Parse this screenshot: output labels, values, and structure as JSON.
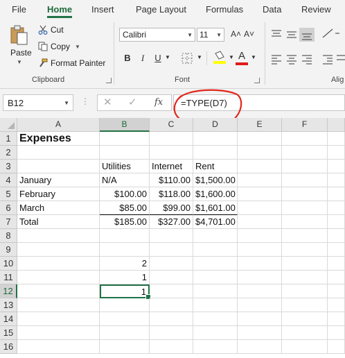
{
  "tabs": [
    "File",
    "Home",
    "Insert",
    "Page Layout",
    "Formulas",
    "Data",
    "Review"
  ],
  "active_tab": "Home",
  "clipboard": {
    "paste_label": "Paste",
    "cut_label": "Cut",
    "copy_label": "Copy",
    "format_painter_label": "Format Painter",
    "group_label": "Clipboard"
  },
  "font": {
    "name": "Calibri",
    "size": "11",
    "bold": "B",
    "italic": "I",
    "underline": "U",
    "grow": "A˄",
    "shrink": "A˅",
    "font_color_glyph": "A",
    "group_label": "Font",
    "fill_color": "#ffff00",
    "font_color": "#e01b1b"
  },
  "alignment": {
    "group_label": "Alig"
  },
  "formula_bar": {
    "name_box": "B12",
    "formula": "=TYPE(D7)",
    "fx": "fx",
    "annotation_color": "#e0261b"
  },
  "grid": {
    "columns": [
      "A",
      "B",
      "C",
      "D",
      "E",
      "F"
    ],
    "selected_column": "B",
    "rows": [
      "1",
      "2",
      "3",
      "4",
      "5",
      "6",
      "7",
      "8",
      "9",
      "10",
      "11",
      "12",
      "13",
      "14",
      "15",
      "16"
    ],
    "selected_row": "12",
    "cells": {
      "A1": "Expenses",
      "B3": "Utilities",
      "C3": "Internet",
      "D3": "Rent",
      "A4": "January",
      "B4": "N/A",
      "C4": "$110.00",
      "D4": "$1,500.00",
      "A5": "February",
      "B5": "$100.00",
      "C5": "$118.00",
      "D5": "$1,600.00",
      "A6": "March",
      "B6": "$85.00",
      "C6": "$99.00",
      "D6": "$1,601.00",
      "A7": "Total",
      "B7": "$185.00",
      "C7": "$327.00",
      "D7": "$4,701.00",
      "B10": "2",
      "B11": "1",
      "B12": "1"
    }
  }
}
